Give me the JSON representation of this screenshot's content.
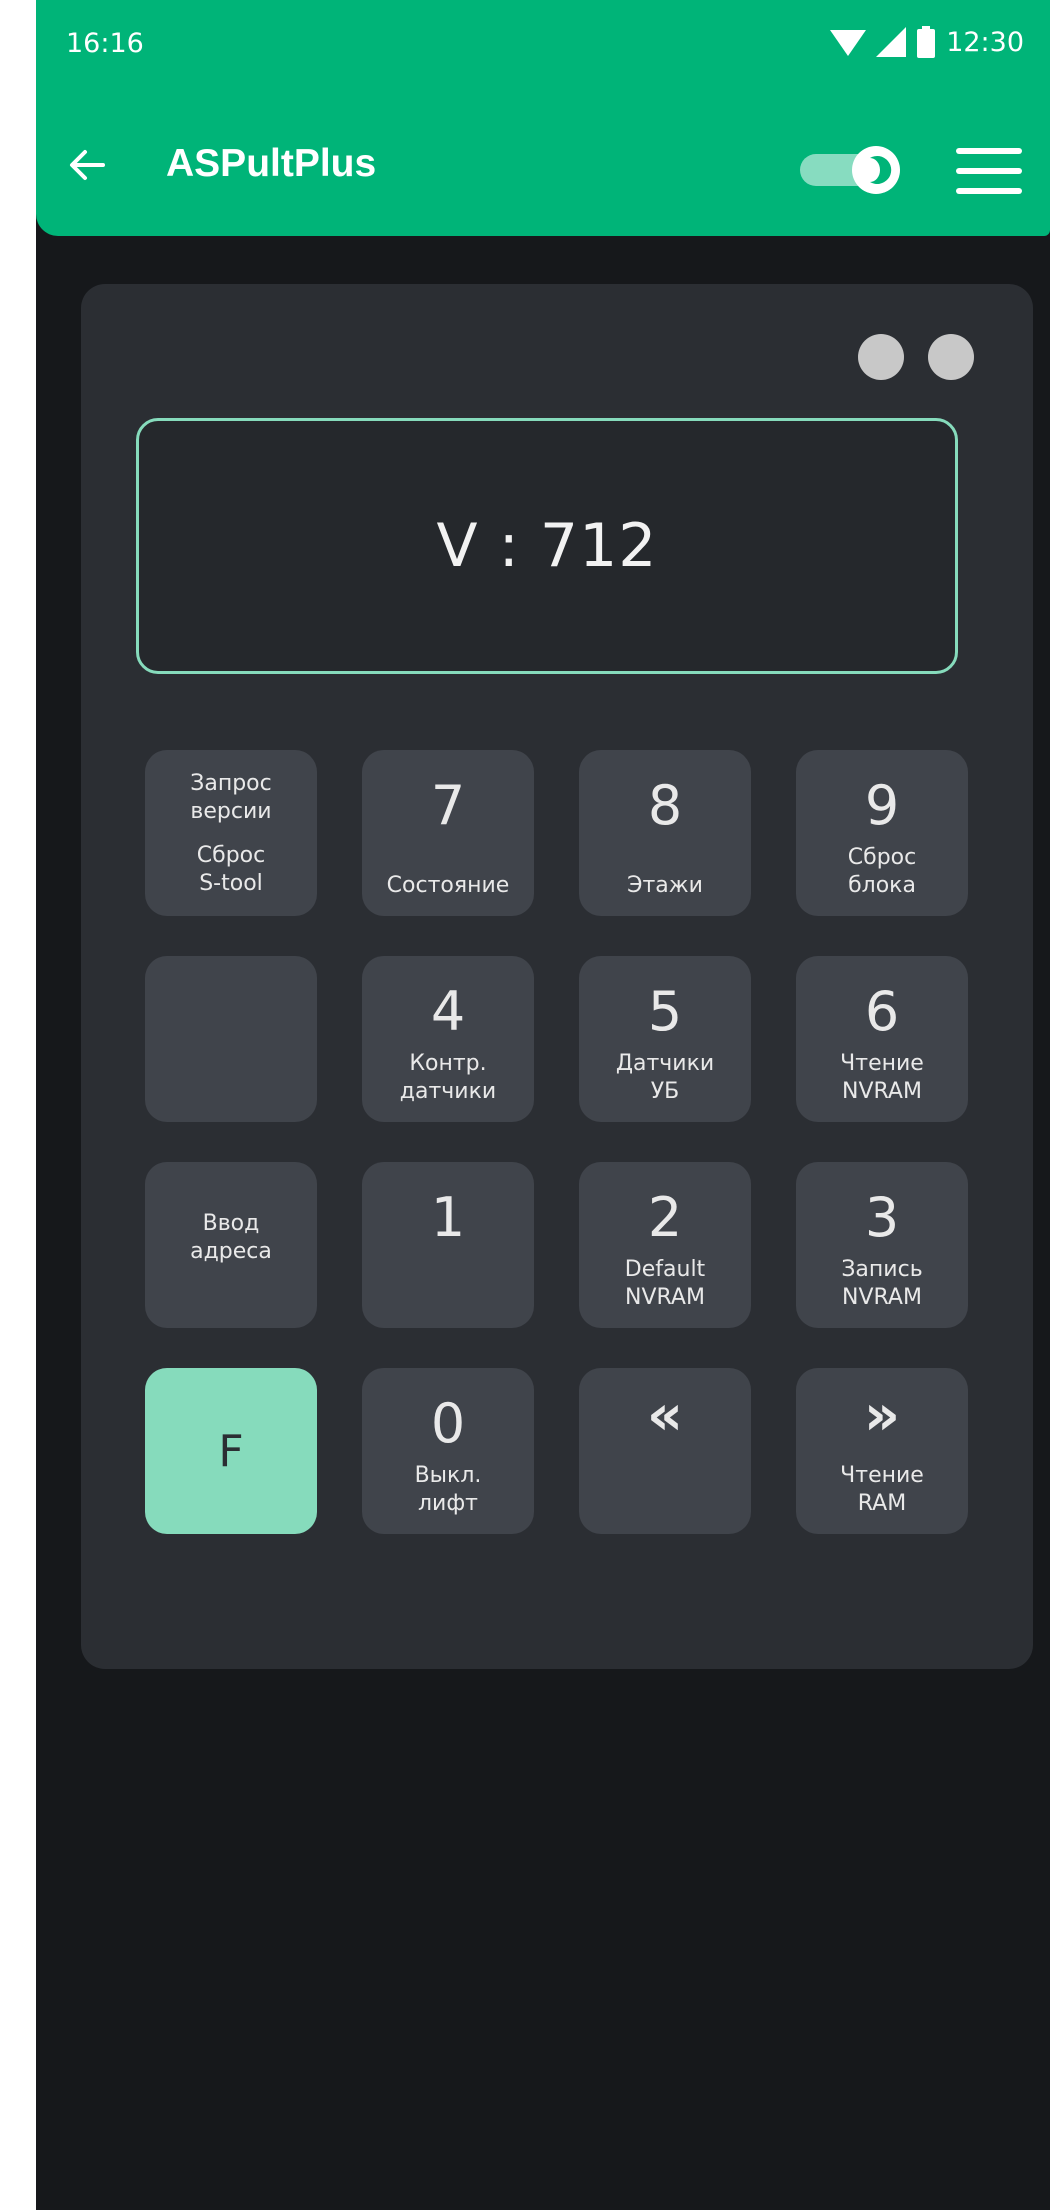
{
  "status_bar": {
    "time_left": "16:16",
    "time_right": "12:30",
    "icons": [
      "wifi-icon",
      "signal-icon",
      "battery-icon"
    ]
  },
  "app_bar": {
    "title": "ASPultPlus",
    "back_icon": "arrow-left-icon",
    "toggle_state": "on",
    "menu_icon": "hamburger-menu-icon"
  },
  "display": {
    "text": "V : 712"
  },
  "keys": {
    "version": {
      "line1": "Запрос",
      "line2": "версии",
      "line3": "Сброс",
      "line4": "S-tool"
    },
    "k7": {
      "digit": "7",
      "label1": "Состояние"
    },
    "k8": {
      "digit": "8",
      "label1": "Этажи"
    },
    "k9": {
      "digit": "9",
      "label1": "Сброс",
      "label2": "блока"
    },
    "k4": {
      "digit": "4",
      "label1": "Контр.",
      "label2": "датчики"
    },
    "k5": {
      "digit": "5",
      "label1": "Датчики",
      "label2": "УБ"
    },
    "k6": {
      "digit": "6",
      "label1": "Чтение",
      "label2": "NVRAM"
    },
    "address": {
      "line1": "Ввод",
      "line2": "адреса"
    },
    "k1": {
      "digit": "1"
    },
    "k2": {
      "digit": "2",
      "label1": "Default",
      "label2": "NVRAM"
    },
    "k3": {
      "digit": "3",
      "label1": "Запись",
      "label2": "NVRAM"
    },
    "f": {
      "label": "F"
    },
    "k0": {
      "digit": "0",
      "label1": "Выкл.",
      "label2": "лифт"
    },
    "prev": {
      "arrow": "«"
    },
    "next": {
      "arrow": "»",
      "label1": "Чтение",
      "label2": "RAM"
    }
  },
  "colors": {
    "header": "#00b478",
    "panel": "#2b2e33",
    "key": "#40444b",
    "accent": "#86dbbc",
    "background": "#16181b"
  }
}
